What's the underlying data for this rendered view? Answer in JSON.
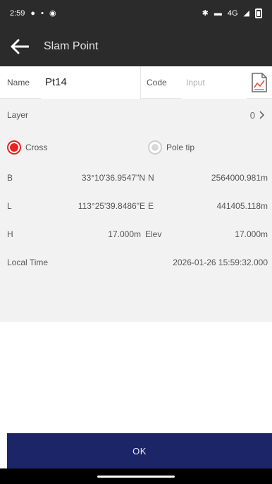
{
  "status": {
    "time": "2:59",
    "signal_text": "4G"
  },
  "appbar": {
    "title": "Slam Point"
  },
  "form": {
    "name_label": "Name",
    "name_value": "Pt14",
    "code_label": "Code",
    "code_placeholder": "Input",
    "layer_label": "Layer",
    "layer_value": "0"
  },
  "modes": [
    {
      "label": "Cross",
      "selected": true
    },
    {
      "label": "Pole tip",
      "selected": false
    }
  ],
  "coords": {
    "b_label": "B",
    "b_value": "33°10'36.9547\"N",
    "n_label": "N",
    "n_value": "2564000.981m",
    "l_label": "L",
    "l_value": "113°25'39.8486\"E",
    "e_label": "E",
    "e_value": "441405.118m",
    "h_label": "H",
    "h_value": "17.000m",
    "elev_label": "Elev",
    "elev_value": "17.000m",
    "time_label": "Local Time",
    "time_value": "2026-01-26 15:59:32.000"
  },
  "footer": {
    "ok_label": "OK"
  },
  "colors": {
    "accent": "#e52424",
    "ok_bar": "#1c2567",
    "bar_bg": "#2b2b2b",
    "row_bg": "#f2f2f2"
  }
}
